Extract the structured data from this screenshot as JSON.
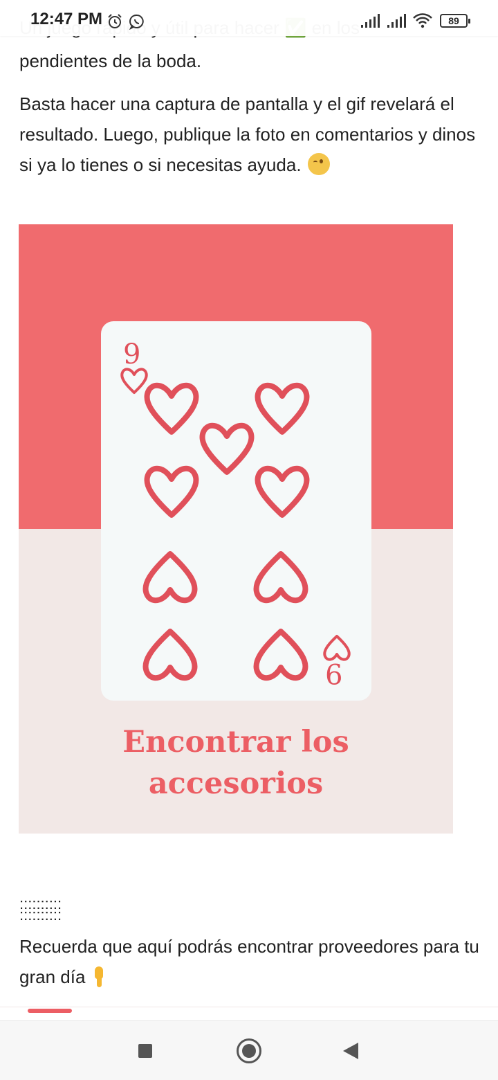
{
  "status_bar": {
    "time": "12:47 PM",
    "battery": "89",
    "icons": [
      "alarm-icon",
      "whatsapp-icon",
      "signal-icon",
      "signal-icon",
      "wifi-icon",
      "battery-icon"
    ]
  },
  "article": {
    "cutoff_line": "Un juego rápido y útil para hacer ✅ en los",
    "paragraph_1": "pendientes de la boda.",
    "paragraph_2": "Basta hacer una captura de pantalla y el gif revelará el resultado. Luego, publique la foto en comentarios y dinos si ya lo tienes o si necesitas ayuda.",
    "paragraph_2_emoji": "winking-face-emoji",
    "promo_image": {
      "card_rank": "9",
      "card_suit": "hearts",
      "caption_line_1": "Encontrar los",
      "caption_line_2": "accesorios",
      "colors": {
        "top": "#f06b6e",
        "bottom": "#f2e8e6",
        "card": "#f5f9f9",
        "heart": "#e0505a",
        "caption": "#ec5e64"
      }
    },
    "separator": "::::::::::\n::::::::::",
    "paragraph_3": "Recuerda que aquí podrás encontrar proveedores para tu gran día",
    "paragraph_3_emoji": "pointing-down-emoji"
  },
  "tab_bar": {
    "active_color": "#ec5e64"
  },
  "nav_bar": {
    "buttons": [
      "recents-button",
      "home-button",
      "back-button"
    ]
  }
}
